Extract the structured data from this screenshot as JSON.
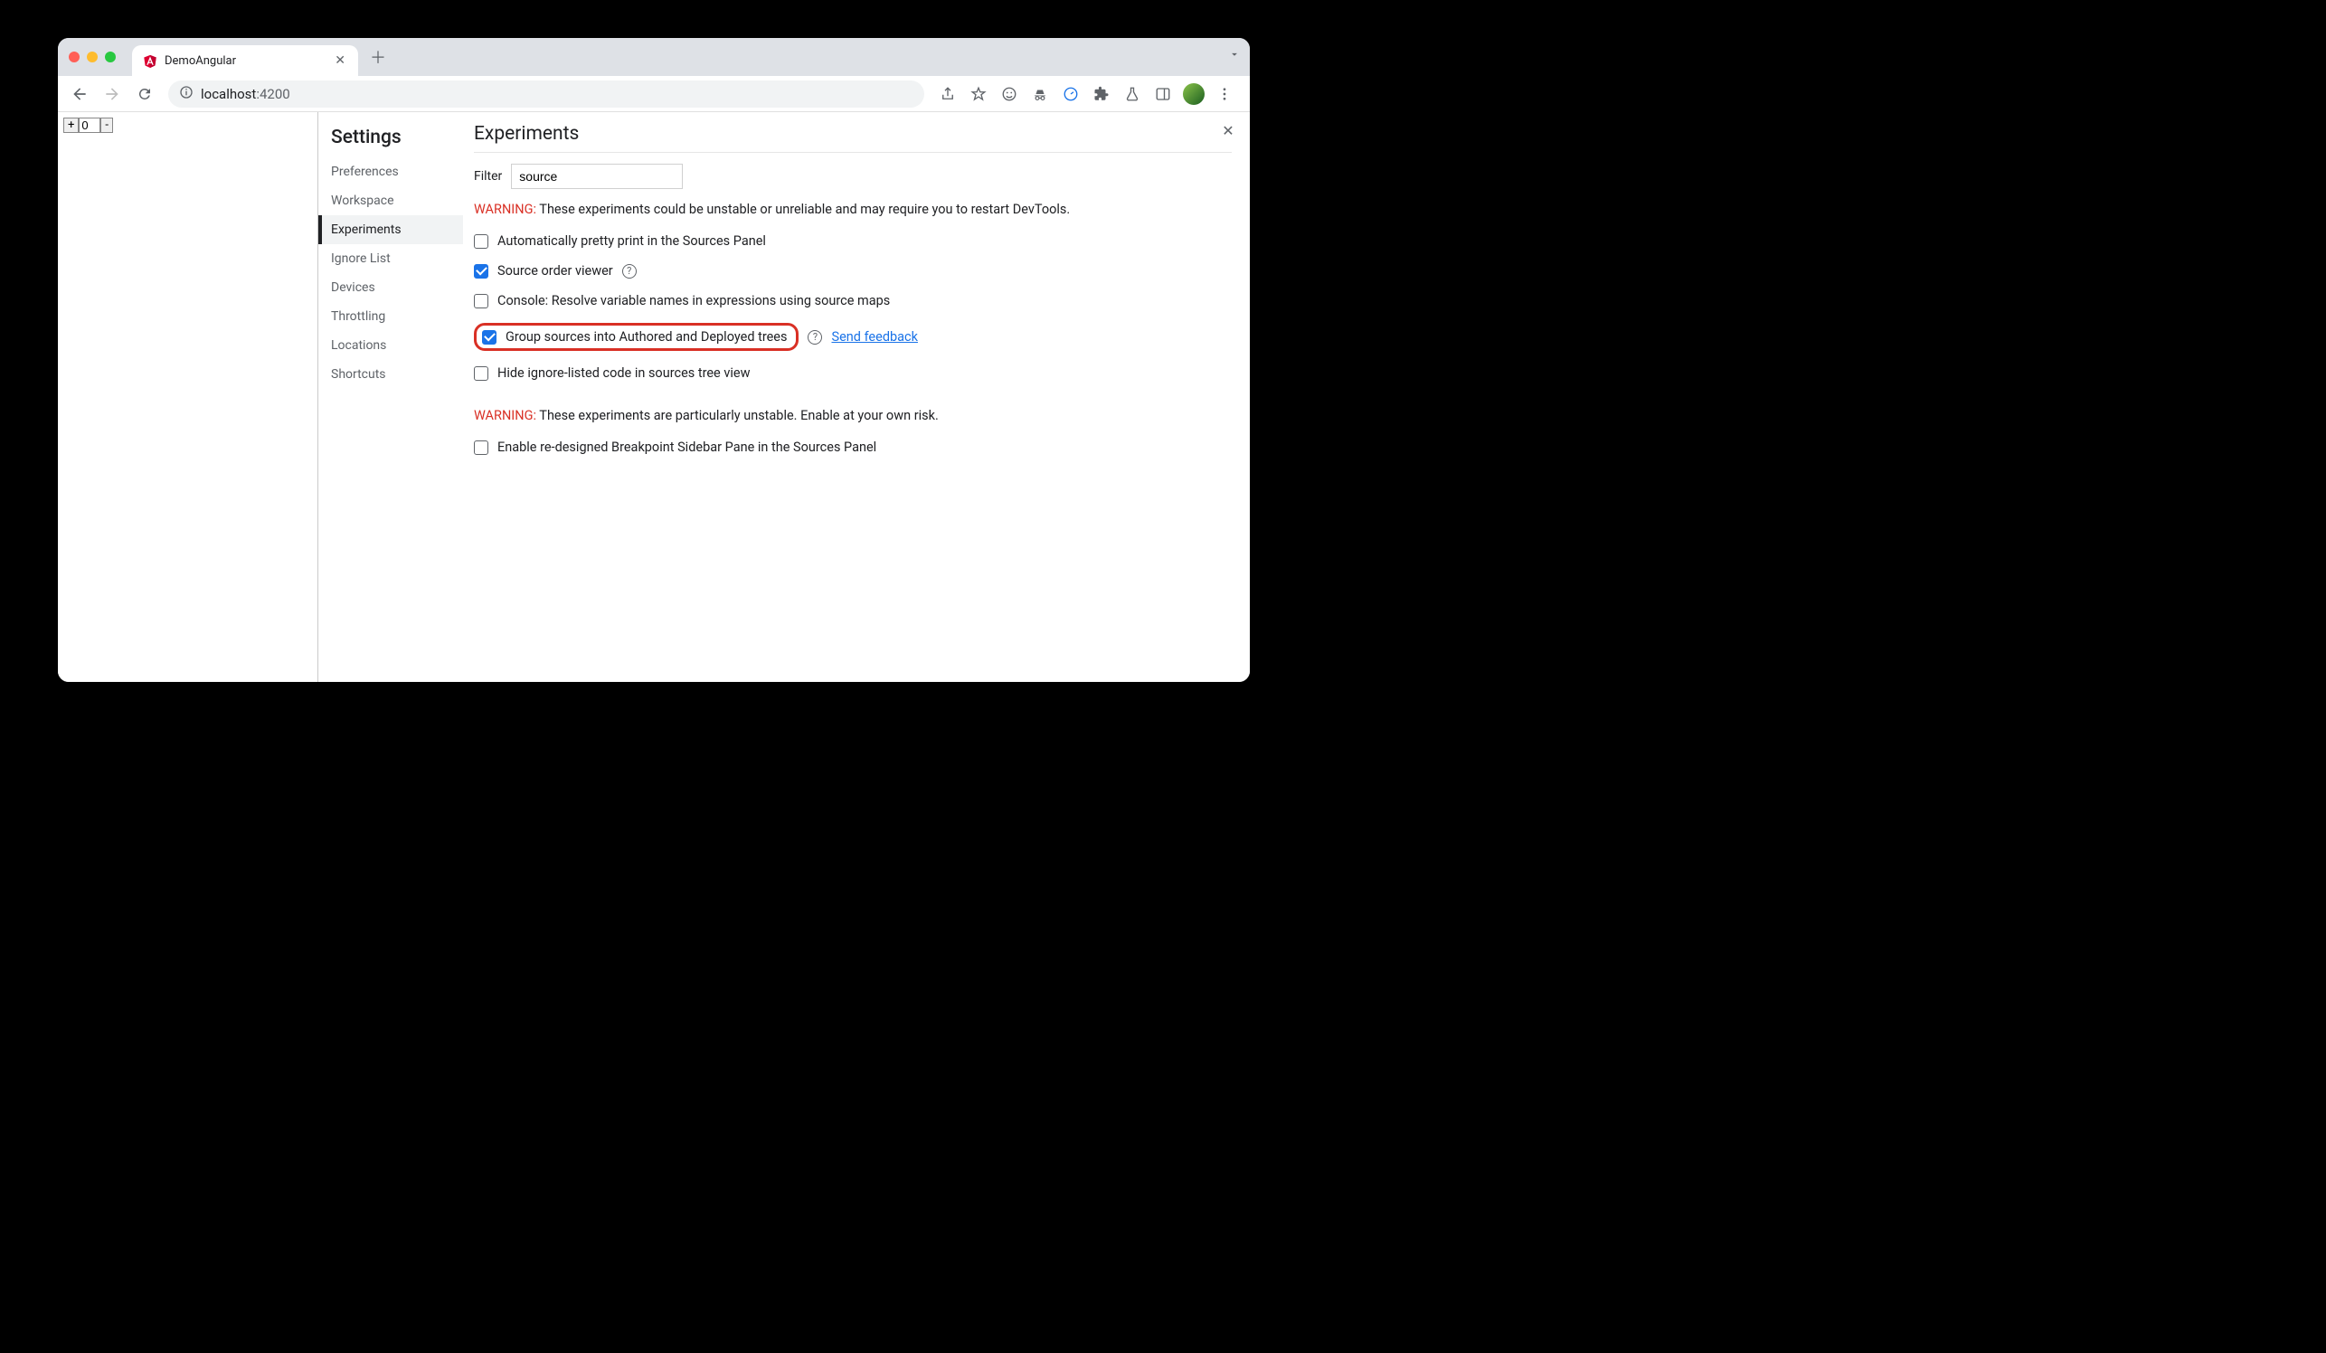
{
  "browser": {
    "tab_title": "DemoAngular",
    "url_host": "localhost",
    "url_port": ":4200"
  },
  "page": {
    "counter_value": "0"
  },
  "settings": {
    "title": "Settings",
    "sidebar": {
      "items": [
        {
          "label": "Preferences"
        },
        {
          "label": "Workspace"
        },
        {
          "label": "Experiments",
          "selected": true
        },
        {
          "label": "Ignore List"
        },
        {
          "label": "Devices"
        },
        {
          "label": "Throttling"
        },
        {
          "label": "Locations"
        },
        {
          "label": "Shortcuts"
        }
      ]
    },
    "main": {
      "heading": "Experiments",
      "filter_label": "Filter",
      "filter_value": "source",
      "warning1_prefix": "WARNING:",
      "warning1_rest": " These experiments could be unstable or unreliable and may require you to restart DevTools.",
      "experiments": [
        {
          "label": "Automatically pretty print in the Sources Panel",
          "checked": false,
          "help": false
        },
        {
          "label": "Source order viewer",
          "checked": true,
          "help": true
        },
        {
          "label": "Console: Resolve variable names in expressions using source maps",
          "checked": false,
          "help": false
        },
        {
          "label": "Group sources into Authored and Deployed trees",
          "checked": true,
          "help": true,
          "highlighted": true,
          "feedback": true,
          "feedback_label": "Send feedback"
        },
        {
          "label": "Hide ignore-listed code in sources tree view",
          "checked": false,
          "help": false
        }
      ],
      "warning2_prefix": "WARNING:",
      "warning2_rest": " These experiments are particularly unstable. Enable at your own risk.",
      "unstable_experiments": [
        {
          "label": "Enable re-designed Breakpoint Sidebar Pane in the Sources Panel",
          "checked": false
        }
      ]
    }
  }
}
